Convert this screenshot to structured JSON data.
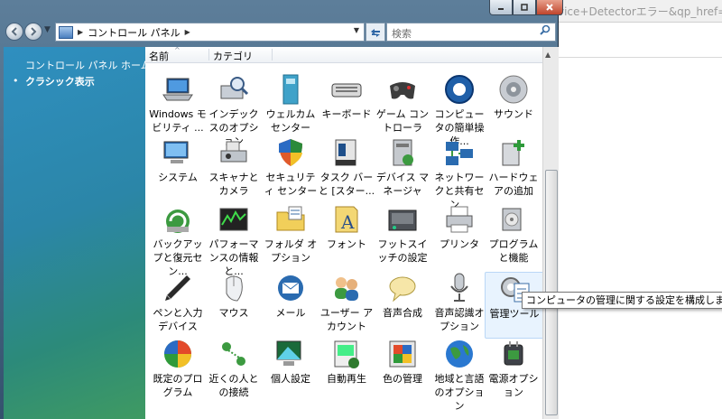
{
  "background_window": {
    "url_fragment": "vice+Detectorエラー&qp_href=i"
  },
  "window": {
    "controls": [
      "minimize",
      "maximize",
      "close"
    ]
  },
  "navigation": {
    "back_icon": "back-arrow-icon",
    "forward_icon": "forward-arrow-icon",
    "breadcrumb": "コントロール パネル",
    "search_placeholder": "検索"
  },
  "sidebar": {
    "home_link": "コントロール パネル ホーム",
    "classic_view": "クラシック表示"
  },
  "columns": {
    "name": "名前",
    "category": "カテゴリ"
  },
  "items": [
    {
      "label": "Windows モビリティ ...",
      "icon": "laptop-icon"
    },
    {
      "label": "インデックスのオプション",
      "icon": "indexing-icon"
    },
    {
      "label": "ウェルカム センター",
      "icon": "welcome-icon"
    },
    {
      "label": "キーボード",
      "icon": "keyboard-icon"
    },
    {
      "label": "ゲーム コントローラ",
      "icon": "gamepad-icon"
    },
    {
      "label": "コンピュータの簡単操作...",
      "icon": "ease-of-access-icon"
    },
    {
      "label": "サウンド",
      "icon": "speaker-icon"
    },
    {
      "label": "システム",
      "icon": "computer-icon"
    },
    {
      "label": "スキャナとカメラ",
      "icon": "scanner-icon"
    },
    {
      "label": "セキュリティ センター",
      "icon": "shield-icon"
    },
    {
      "label": "タスク バーと [スター...",
      "icon": "taskbar-icon"
    },
    {
      "label": "デバイス マネージャ",
      "icon": "device-manager-icon"
    },
    {
      "label": "ネットワークと共有セン...",
      "icon": "network-icon"
    },
    {
      "label": "ハードウェアの追加",
      "icon": "add-hardware-icon"
    },
    {
      "label": "バックアップと復元セン...",
      "icon": "backup-icon"
    },
    {
      "label": "パフォーマンスの情報と...",
      "icon": "performance-icon"
    },
    {
      "label": "フォルダ オプション",
      "icon": "folder-icon"
    },
    {
      "label": "フォント",
      "icon": "font-icon"
    },
    {
      "label": "フットスイッチの設定",
      "icon": "footswitch-icon"
    },
    {
      "label": "プリンタ",
      "icon": "printer-icon"
    },
    {
      "label": "プログラムと機能",
      "icon": "programs-icon"
    },
    {
      "label": "ペンと入力デバイス",
      "icon": "pen-icon"
    },
    {
      "label": "マウス",
      "icon": "mouse-icon"
    },
    {
      "label": "メール",
      "icon": "mail-icon"
    },
    {
      "label": "ユーザー アカウント",
      "icon": "users-icon"
    },
    {
      "label": "音声合成",
      "icon": "speech-icon"
    },
    {
      "label": "音声認識オプション",
      "icon": "microphone-icon"
    },
    {
      "label": "管理ツール",
      "icon": "admin-tools-icon"
    },
    {
      "label": "既定のプログラム",
      "icon": "default-programs-icon"
    },
    {
      "label": "近くの人との接続",
      "icon": "people-near-me-icon"
    },
    {
      "label": "個人設定",
      "icon": "personalization-icon"
    },
    {
      "label": "自動再生",
      "icon": "autoplay-icon"
    },
    {
      "label": "色の管理",
      "icon": "color-management-icon"
    },
    {
      "label": "地域と言語のオプション",
      "icon": "globe-icon"
    },
    {
      "label": "電源オプション",
      "icon": "power-icon"
    }
  ],
  "tooltip": "コンピュータの管理に関する設定を構成します。",
  "colors": {
    "accent": "#2d65a5",
    "task_pane_top": "#2f8fc0",
    "task_pane_bottom": "#3f9a62"
  }
}
